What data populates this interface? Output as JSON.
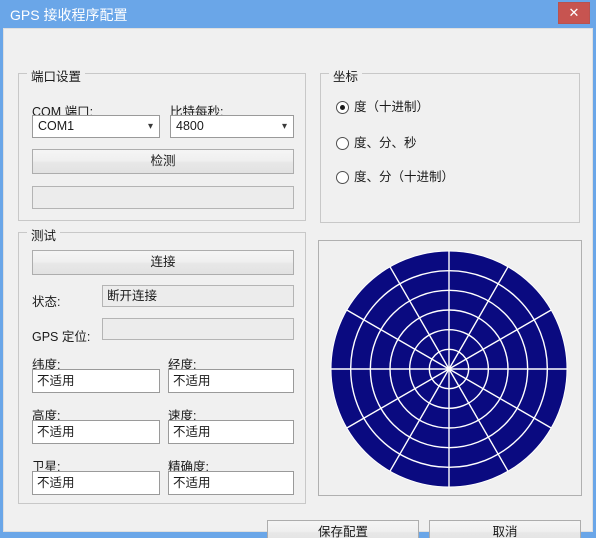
{
  "window": {
    "title": "GPS 接收程序配置",
    "close_label": "✕",
    "titlebar_color": "#6aa6e8",
    "close_color": "#c75450"
  },
  "port_settings": {
    "group_title": "端口设置",
    "com_port_label": "COM 端口:",
    "com_port_value": "COM1",
    "baud_label": "比特每秒:",
    "baud_value": "4800",
    "detect_button": "检测",
    "detect_result_value": ""
  },
  "coordinates": {
    "group_title": "坐标",
    "options": [
      {
        "label": "度（十进制）",
        "selected": true
      },
      {
        "label": "度、分、秒",
        "selected": false
      },
      {
        "label": "度、分（十进制）",
        "selected": false
      }
    ]
  },
  "test": {
    "group_title": "测试",
    "connect_button": "连接",
    "status_label": "状态:",
    "status_value": "断开连接",
    "gps_fix_label": "GPS 定位:",
    "gps_fix_value": "",
    "fields": [
      {
        "label": "纬度:",
        "value": "不适用"
      },
      {
        "label": "经度:",
        "value": "不适用"
      },
      {
        "label": "高度:",
        "value": "不适用"
      },
      {
        "label": "速度:",
        "value": "不适用"
      },
      {
        "label": "卫星:",
        "value": "不适用"
      },
      {
        "label": "精确度:",
        "value": "不适用"
      }
    ]
  },
  "skyplot": {
    "fill_color": "#0a0a80",
    "grid_color": "#ffffff",
    "rings": 6,
    "spokes": 12,
    "satellites": []
  },
  "footer": {
    "save_button": "保存配置",
    "cancel_button": "取消"
  }
}
